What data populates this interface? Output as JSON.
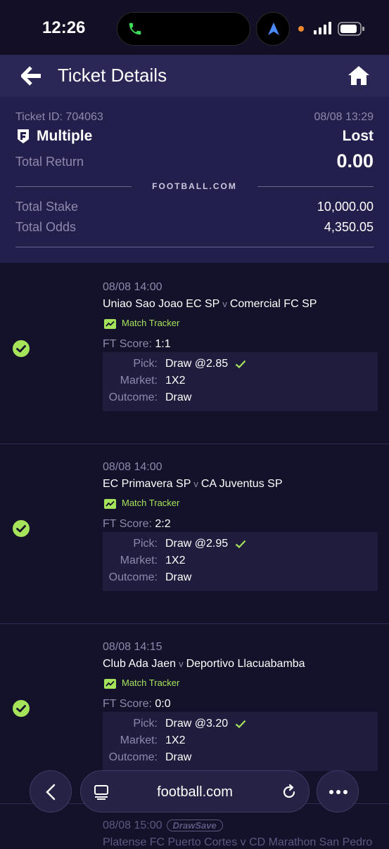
{
  "status_bar": {
    "time": "12:26"
  },
  "header": {
    "title": "Ticket Details"
  },
  "ticket": {
    "id_label": "Ticket ID: 704063",
    "date": "08/08 13:29",
    "type": "Multiple",
    "status": "Lost",
    "return_label": "Total Return",
    "return_value": "0.00",
    "brand": "FOOTBALL.COM",
    "stake_label": "Total Stake",
    "stake_value": "10,000.00",
    "odds_label": "Total Odds",
    "odds_value": "4,350.05"
  },
  "labels": {
    "match_tracker": "Match Tracker",
    "ft_score": "FT Score:",
    "pick": "Pick:",
    "market": "Market:",
    "outcome": "Outcome:",
    "vs": "v"
  },
  "matches": [
    {
      "datetime": "08/08 14:00",
      "home": "Uniao Sao Joao EC SP",
      "away": "Comercial FC SP",
      "score": "1:1",
      "pick": "Draw @2.85",
      "market": "1X2",
      "outcome": "Draw"
    },
    {
      "datetime": "08/08 14:00",
      "home": "EC Primavera SP",
      "away": "CA Juventus SP",
      "score": "2:2",
      "pick": "Draw @2.95",
      "market": "1X2",
      "outcome": "Draw"
    },
    {
      "datetime": "08/08 14:15",
      "home": "Club Ada Jaen",
      "away": "Deportivo Llacuabamba",
      "score": "0:0",
      "pick": "Draw @3.20",
      "market": "1X2",
      "outcome": "Draw"
    }
  ],
  "partial_match": {
    "datetime": "08/08 15:00",
    "badge": "DrawSave",
    "teams": "Platense FC Puerto Cortes v CD Marathon San Pedro"
  },
  "browser": {
    "url": "football.com"
  },
  "colors": {
    "accent_green": "#a5e35b",
    "header_bg": "#2a2655",
    "summary_bg": "#231f4d",
    "page_bg": "#14112a"
  }
}
